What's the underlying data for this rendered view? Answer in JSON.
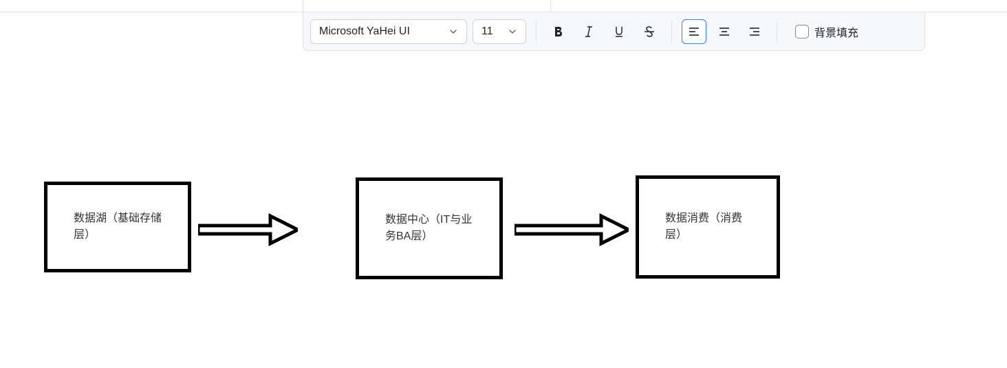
{
  "toolbar": {
    "font_name": "Microsoft YaHei UI",
    "font_size": "11",
    "bg_fill_label": "背景填充"
  },
  "diagram": {
    "boxes": [
      {
        "text": "数据湖（基础存储层）"
      },
      {
        "text": "数据中心（IT与业务BA层）"
      },
      {
        "text": "数据消费（消费层）"
      }
    ]
  }
}
